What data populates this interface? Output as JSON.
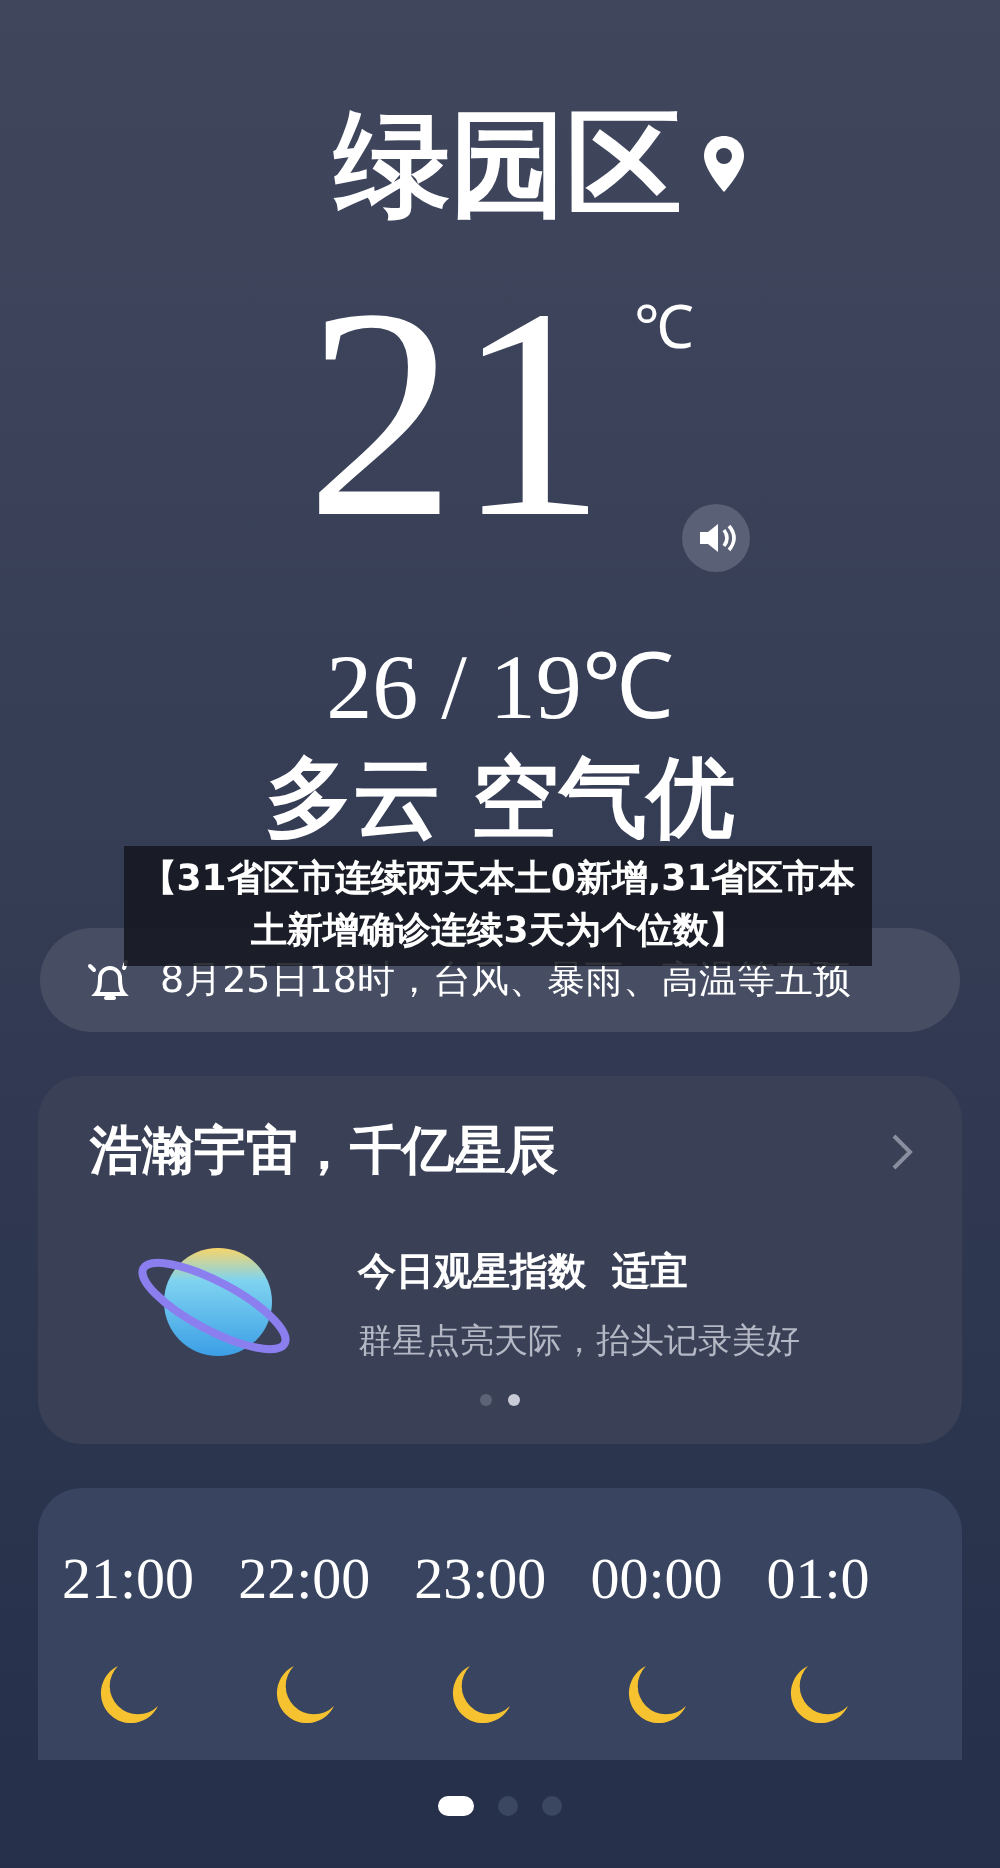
{
  "city": "绿园区",
  "temperature": "21",
  "unit": "℃",
  "range": "26 / 19℃",
  "condition": "多云 空气优",
  "headline": "【31省区市连续两天本土0新增,31省区市本土新增确诊连续3天为个位数】",
  "alert": "8月25日18时，台风、暴雨、高温等五预",
  "star_card": {
    "title": "浩瀚宇宙，千亿星辰",
    "index_label": "今日观星指数",
    "index_value": "适宜",
    "subtitle": "群星点亮天际，抬头记录美好",
    "dots": [
      {
        "selected": false
      },
      {
        "selected": true
      }
    ]
  },
  "hourly": [
    {
      "time": "21:00"
    },
    {
      "time": "22:00"
    },
    {
      "time": "23:00"
    },
    {
      "time": "00:00"
    },
    {
      "time": "01:0"
    }
  ],
  "pages": [
    {
      "selected": true
    },
    {
      "selected": false
    },
    {
      "selected": false
    }
  ]
}
